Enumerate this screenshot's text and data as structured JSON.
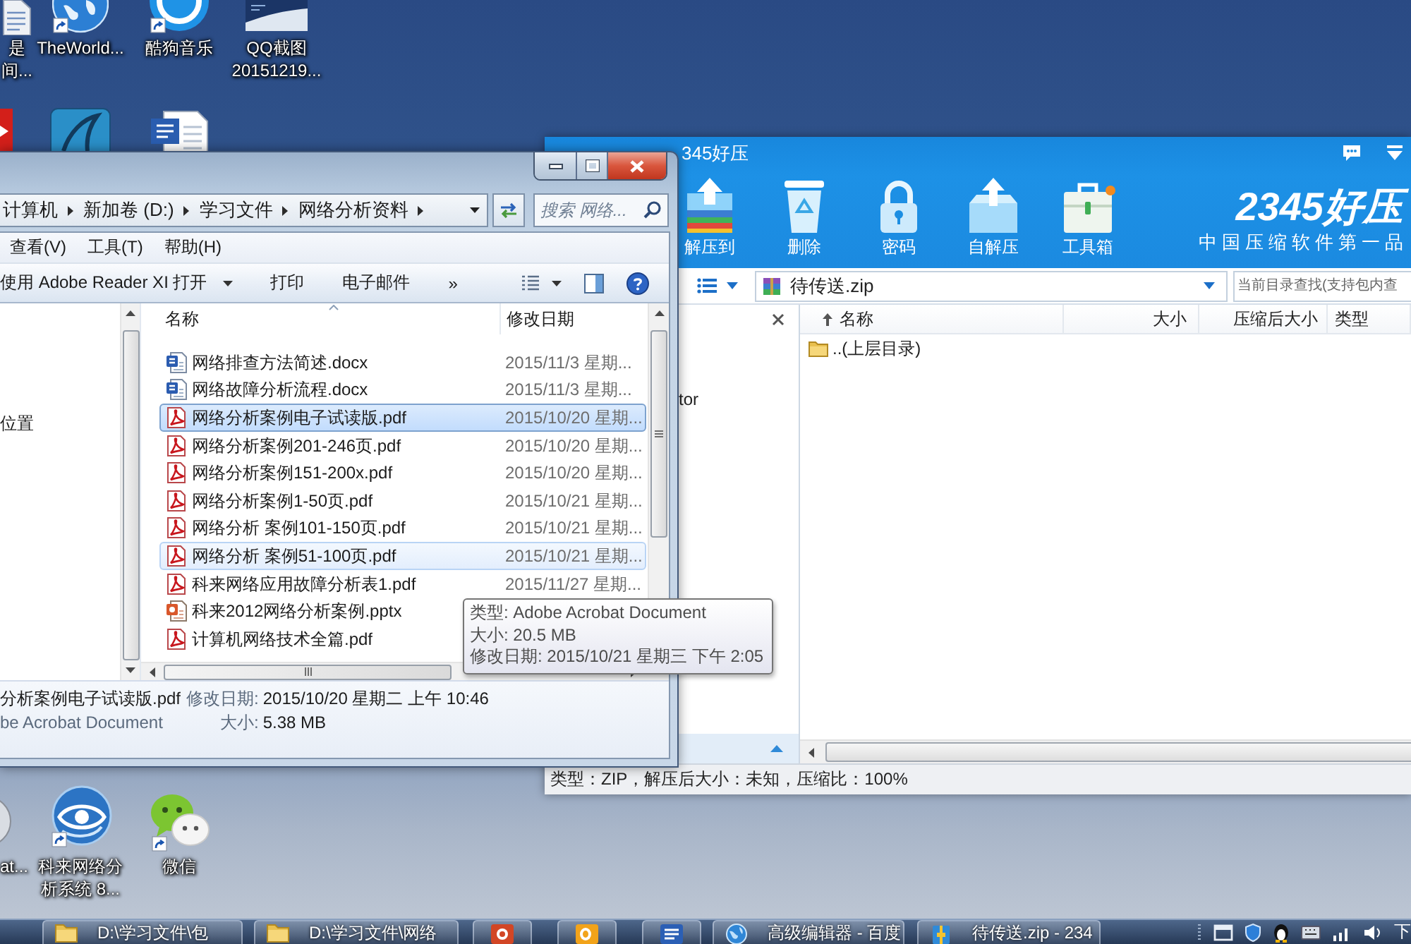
{
  "desktop_icons": [
    {
      "kind": "document",
      "lines": [
        "是",
        "间..."
      ]
    },
    {
      "kind": "globe",
      "lines": [
        "TheWorld..."
      ]
    },
    {
      "kind": "music",
      "lines": [
        "酷狗音乐"
      ]
    },
    {
      "kind": "screenshot",
      "lines": [
        "QQ截图",
        "20151219..."
      ]
    },
    {
      "kind": "red-app"
    },
    {
      "kind": "fin-app"
    },
    {
      "kind": "word-doc"
    },
    {
      "kind": "sphere",
      "lines": [
        "at..."
      ]
    },
    {
      "kind": "network-analyzer",
      "lines": [
        "科来网络分",
        "析系统 8..."
      ]
    },
    {
      "kind": "wechat",
      "lines": [
        "微信"
      ]
    }
  ],
  "explorer": {
    "breadcrumb": [
      "计算机",
      "新加卷 (D:)",
      "学习文件",
      "网络分析资料"
    ],
    "search": {
      "placeholder": "搜索 网络..."
    },
    "menu": [
      "查看(V)",
      "工具(T)",
      "帮助(H)"
    ],
    "commands": [
      {
        "label": "使用 Adobe Reader XI 打开",
        "dropdown": true
      },
      {
        "label": "打印",
        "dropdown": false
      },
      {
        "label": "电子邮件",
        "dropdown": false
      },
      {
        "label": "»",
        "dropdown": false
      }
    ],
    "nav_items": [
      "位置"
    ],
    "columns": [
      "名称",
      "修改日期"
    ],
    "files": [
      {
        "name": "网络排查方法简述.docx",
        "date": "2015/11/3 星期...",
        "kind": "word",
        "selected": false,
        "hovered": false
      },
      {
        "name": "网络故障分析流程.docx",
        "date": "2015/11/3 星期...",
        "kind": "word",
        "selected": false,
        "hovered": false
      },
      {
        "name": "网络分析案例电子试读版.pdf",
        "date": "2015/10/20 星期...",
        "kind": "pdf",
        "selected": true,
        "hovered": false
      },
      {
        "name": "网络分析案例201-246页.pdf",
        "date": "2015/10/20 星期...",
        "kind": "pdf",
        "selected": false,
        "hovered": false
      },
      {
        "name": "网络分析案例151-200x.pdf",
        "date": "2015/10/20 星期...",
        "kind": "pdf",
        "selected": false,
        "hovered": false
      },
      {
        "name": "网络分析案例1-50页.pdf",
        "date": "2015/10/21 星期...",
        "kind": "pdf",
        "selected": false,
        "hovered": false
      },
      {
        "name": "网络分析 案例101-150页.pdf",
        "date": "2015/10/21 星期...",
        "kind": "pdf",
        "selected": false,
        "hovered": false
      },
      {
        "name": "网络分析 案例51-100页.pdf",
        "date": "2015/10/21 星期...",
        "kind": "pdf",
        "selected": false,
        "hovered": true
      },
      {
        "name": "科来网络应用故障分析表1.pdf",
        "date": "2015/11/27 星期...",
        "kind": "pdf",
        "selected": false,
        "hovered": false
      },
      {
        "name": "科来2012网络分析案例.pptx",
        "kind": "ppt",
        "selected": false,
        "hovered": false
      },
      {
        "name": "计算机网络技术全篇.pdf",
        "kind": "pdf",
        "selected": false,
        "hovered": false
      }
    ],
    "details": {
      "name": "分析案例电子试读版.pdf",
      "type": "be Acrobat Document",
      "fields": [
        {
          "label": "修改日期:",
          "value": "2015/10/20 星期二 上午 10:46"
        },
        {
          "label": "大小:",
          "value": "5.38 MB"
        }
      ]
    }
  },
  "tooltip": [
    "类型: Adobe Acrobat Document",
    "大小: 20.5 MB",
    "修改日期: 2015/10/21 星期三 下午 2:05"
  ],
  "haozip": {
    "title": "345好压",
    "tools": [
      {
        "kind": "extract",
        "label": "解压到"
      },
      {
        "kind": "delete",
        "label": "删除"
      },
      {
        "kind": "password",
        "label": "密码"
      },
      {
        "kind": "self-extract",
        "label": "自解压"
      },
      {
        "kind": "toolbox",
        "label": "工具箱"
      }
    ],
    "logo": "2345好压",
    "slogan": "中国压缩软件第一品",
    "path": "待传送.zip",
    "search": {
      "placeholder": "当前目录查找(支持包内查"
    },
    "tree": [
      "tor"
    ],
    "columns": [
      {
        "label": "名称",
        "sorted": true
      },
      {
        "label": "大小",
        "sorted": false
      },
      {
        "label": "压缩后大小",
        "sorted": false
      },
      {
        "label": "类型",
        "sorted": false
      }
    ],
    "rows": [
      {
        "name": "..(上层目录)",
        "kind": "folder"
      }
    ],
    "status": "类型：ZIP，解压后大小：未知，压缩比：100%"
  },
  "taskbar": {
    "items": [
      {
        "kind": "folder",
        "label": "D:\\学习文件\\包"
      },
      {
        "kind": "folder",
        "label": "D:\\学习文件\\网络"
      },
      {
        "kind": "powerpoint"
      },
      {
        "kind": "outlook"
      },
      {
        "kind": "word"
      },
      {
        "kind": "browser",
        "label": "高级编辑器 - 百度"
      },
      {
        "kind": "archive",
        "label": "待传送.zip - 234"
      }
    ],
    "clock": "下"
  }
}
